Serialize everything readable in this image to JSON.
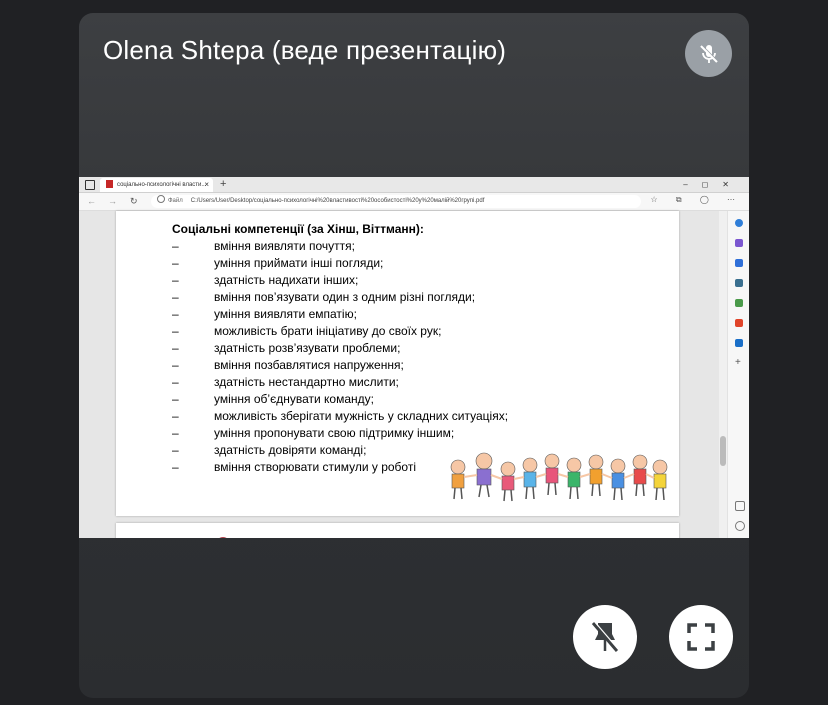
{
  "meeting": {
    "presenter_label": "Olena Shtepa (веде презентацію)"
  },
  "browser": {
    "tab_title": "соціально-психологічні власти...",
    "url_prefix": "Файл",
    "url": "C:/Users/User/Desktop/соціально-психологічні%20властивості%20особистості%20у%20малій%20групі.pdf"
  },
  "document": {
    "heading": "Соціальні компетенції  (за Хінш, Віттманн):",
    "items": [
      {
        "dash": "–",
        "text": "вміння виявляти почуття;"
      },
      {
        "dash": "–",
        "text": "уміння приймати інші погляди;"
      },
      {
        "dash": "–",
        "text": "здатність надихати інших;"
      },
      {
        "dash": "–",
        "text": "вміння пов’язувати один з одним різні погляди;"
      },
      {
        "dash": "–",
        "text": "уміння виявляти емпатію;"
      },
      {
        "dash": "–",
        "text": "можливість брати ініціативу до своїх рук;"
      },
      {
        "dash": "–",
        "text": "здатність розв’язувати проблеми;"
      },
      {
        "dash": "–",
        "text": "вміння позбавлятися напруження;"
      },
      {
        "dash": "–",
        "text": "здатність нестандартно мислити;"
      },
      {
        "dash": "–",
        "text": "уміння об’єднувати команду;"
      },
      {
        "dash": "–",
        "text": "можливість зберігати мужність у складних ситуаціях;"
      },
      {
        "dash": "–",
        "text": "уміння пропонувати свою підтримку іншим;"
      },
      {
        "dash": "–",
        "text": "здатність довіряти команді;"
      },
      {
        "dash": "–",
        "text": "вміння створювати стимули у роботі"
      }
    ]
  },
  "icons": {
    "mute": "microphone-off-icon",
    "pin": "unpin-icon",
    "fullscreen": "fullscreen-icon"
  },
  "colors": {
    "tile_bg": "#3c4043",
    "page_bg": "#202124",
    "mute_bg": "#9aa0a6"
  }
}
